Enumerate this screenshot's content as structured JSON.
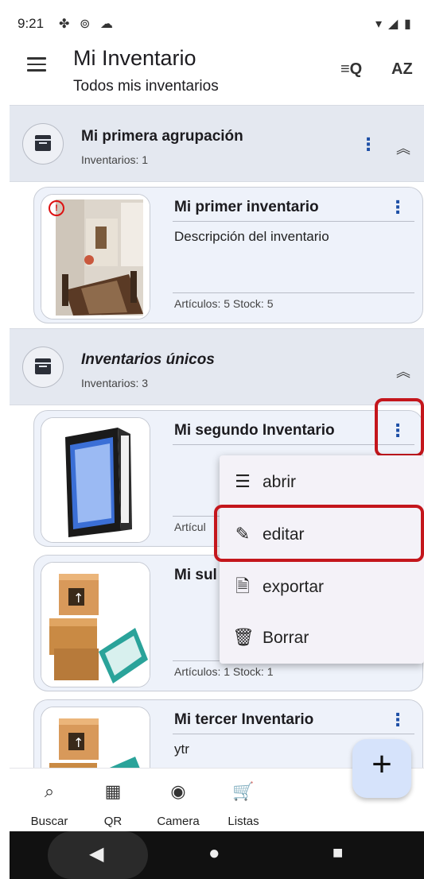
{
  "status": {
    "time": "9:21"
  },
  "app": {
    "title": "Mi Inventario",
    "subtitle": "Todos mis inventarios"
  },
  "appbar_icons": [
    "filter-search-icon",
    "sort-az-icon"
  ],
  "groups": [
    {
      "title": "Mi primera agrupación",
      "count": "Inventarios: 1"
    },
    {
      "title": "Inventarios únicos",
      "count": "Inventarios: 3"
    }
  ],
  "cards": [
    {
      "title": "Mi primer inventario",
      "description": "Descripción del inventario",
      "meta": "Artículos: 5   Stock: 5"
    },
    {
      "title": "Mi segundo Inventario",
      "description": "",
      "meta": "Artícul"
    },
    {
      "title": "Mi sul",
      "description": "",
      "meta": "Artículos: 1   Stock: 1"
    },
    {
      "title": "Mi tercer Inventario",
      "description": "ytr",
      "meta": ""
    }
  ],
  "popup_menu": {
    "items": [
      {
        "label": "abrir",
        "icon": "list-icon"
      },
      {
        "label": "editar",
        "icon": "pencil-icon"
      },
      {
        "label": "exportar",
        "icon": "file-export-icon"
      },
      {
        "label": "Borrar",
        "icon": "trash-icon"
      }
    ]
  },
  "bottom_nav": [
    {
      "label": "Buscar",
      "icon": "search-icon"
    },
    {
      "label": "QR",
      "icon": "qr-icon"
    },
    {
      "label": "Camera",
      "icon": "camera-icon"
    },
    {
      "label": "Listas",
      "icon": "cart-icon"
    }
  ],
  "colors": {
    "accent": "#1d4fa6",
    "highlight": "#c4161c",
    "group_bg": "#e4e8f0",
    "card_bg": "#eef2fa"
  }
}
